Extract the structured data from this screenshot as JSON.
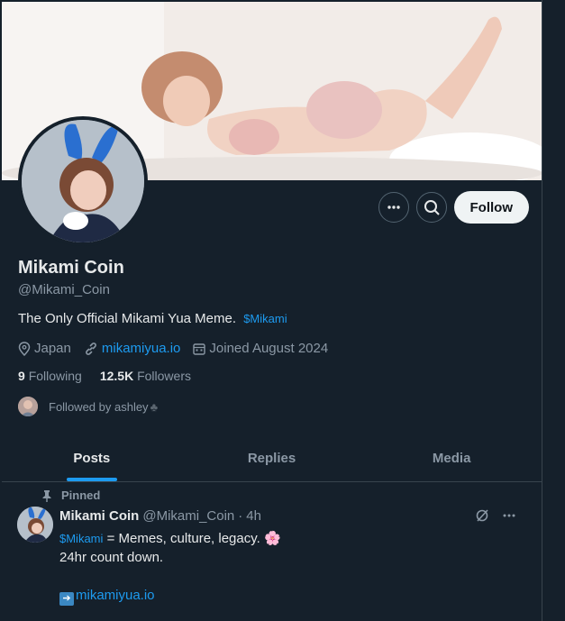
{
  "profile": {
    "name": "Mikami Coin",
    "handle": "@Mikami_Coin",
    "bio_text": "The Only Official Mikami Yua Meme.",
    "bio_cashtag": "$Mikami",
    "location": "Japan",
    "website": "mikamiyua.io",
    "joined": "Joined August 2024",
    "following_count": "9",
    "following_label": "Following",
    "followers_count": "12.5K",
    "followers_label": "Followers",
    "followed_by": "Followed by ashley"
  },
  "actions": {
    "more_icon": "more-icon",
    "search_icon": "search-icon",
    "follow_label": "Follow"
  },
  "tabs": [
    {
      "label": "Posts",
      "active": true
    },
    {
      "label": "Replies",
      "active": false
    },
    {
      "label": "Media",
      "active": false
    }
  ],
  "tweet": {
    "pinned_label": "Pinned",
    "author_name": "Mikami Coin",
    "author_handle": "@Mikami_Coin",
    "sep": "·",
    "time": "4h",
    "line1_cashtag": "$Mikami",
    "line1_text": "= Memes, culture, legacy. 🌸",
    "line2": "24hr count down.",
    "link": "mikamiyua.io"
  },
  "colors": {
    "background": "#15202b",
    "accent": "#1d9bf0",
    "muted": "#8b98a5",
    "text": "#e7e9ea"
  }
}
